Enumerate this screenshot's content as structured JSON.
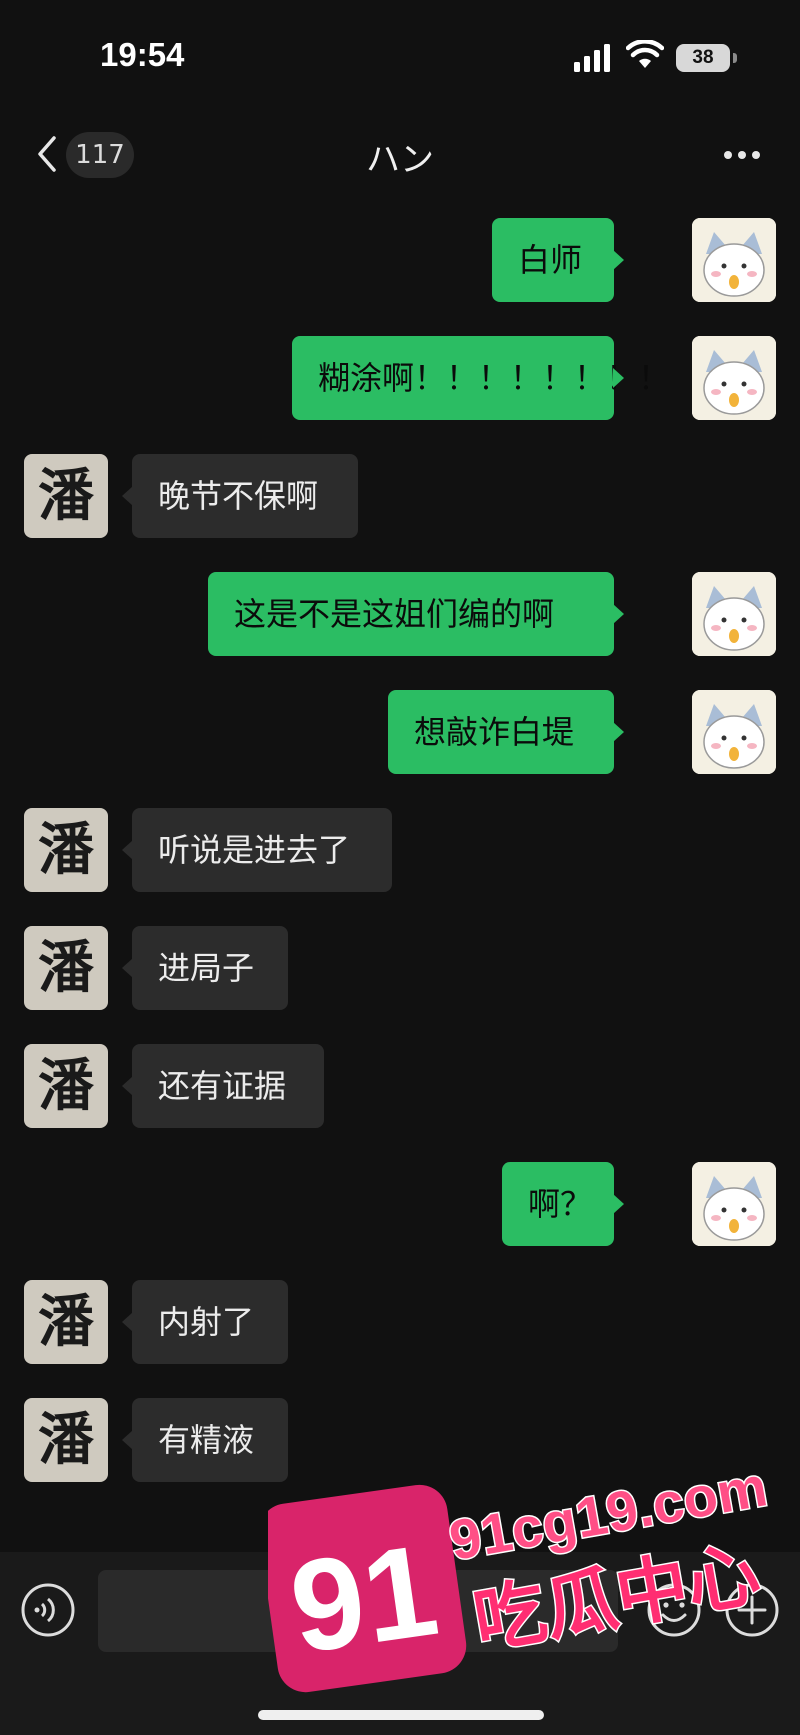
{
  "status": {
    "time": "19:54",
    "battery": "38"
  },
  "nav": {
    "back_count": "117",
    "title": "ハン"
  },
  "messages": [
    {
      "dir": "out",
      "text": "白师"
    },
    {
      "dir": "out",
      "text": "糊涂啊！！！！！！！！"
    },
    {
      "dir": "in",
      "text": "晚节不保啊"
    },
    {
      "dir": "out",
      "text": "这是不是这姐们编的啊"
    },
    {
      "dir": "out",
      "text": "想敲诈白堤"
    },
    {
      "dir": "in",
      "text": "听说是进去了"
    },
    {
      "dir": "in",
      "text": "进局子"
    },
    {
      "dir": "in",
      "text": "还有证据"
    },
    {
      "dir": "out",
      "text": "啊？"
    },
    {
      "dir": "in",
      "text": "内射了"
    },
    {
      "dir": "in",
      "text": "有精液"
    }
  ],
  "contact_avatar_char": "潘",
  "watermark": {
    "number": "91",
    "domain": "91cg19.com",
    "name": "吃瓜中心"
  },
  "colors": {
    "outgoing": "#2bbd63",
    "incoming": "#2c2c2c",
    "background": "#111111"
  },
  "icons": [
    "back-chevron-icon",
    "more-dots-icon",
    "voice-icon",
    "emoji-icon",
    "plus-icon"
  ]
}
